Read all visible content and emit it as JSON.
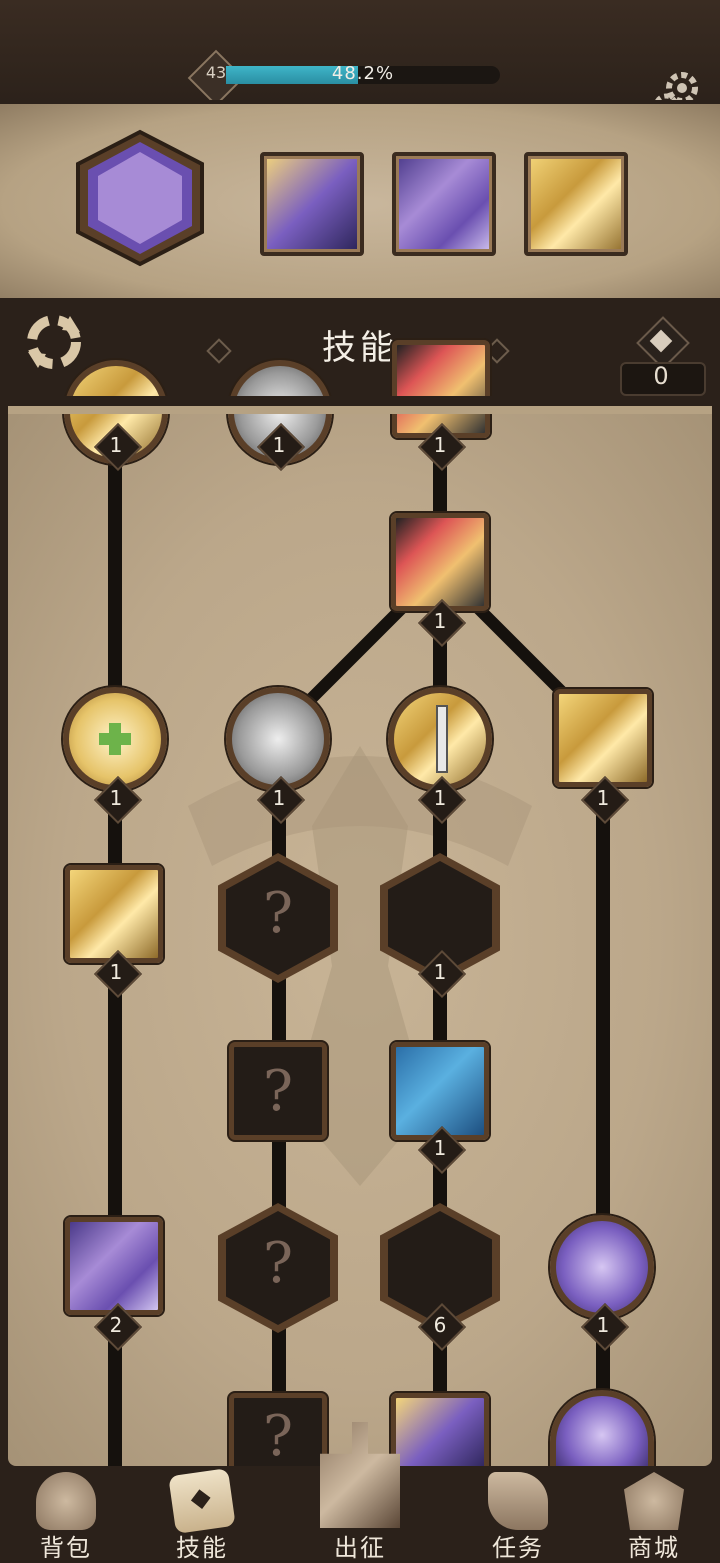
{
  "header": {
    "level": "43",
    "progress_text": "48.2%",
    "progress_fraction": 0.482
  },
  "title_bar": {
    "title": "技能",
    "points": "0"
  },
  "tree": {
    "top_row_badges": [
      "1",
      "1",
      "1"
    ],
    "badges": {
      "red_sword": "1",
      "heal": "1",
      "armor": "1",
      "holy_sword": "1",
      "gold_burst": "1",
      "gold_strike": "1",
      "blue_sword_hex": "1",
      "blue_dagger": "1",
      "purple_knight": "2",
      "purple_hex": "6",
      "chains": "1"
    }
  },
  "nav": {
    "items": [
      {
        "label": "背包"
      },
      {
        "label": "技能"
      },
      {
        "label": "出征"
      },
      {
        "label": "任务"
      },
      {
        "label": "商城"
      }
    ]
  }
}
